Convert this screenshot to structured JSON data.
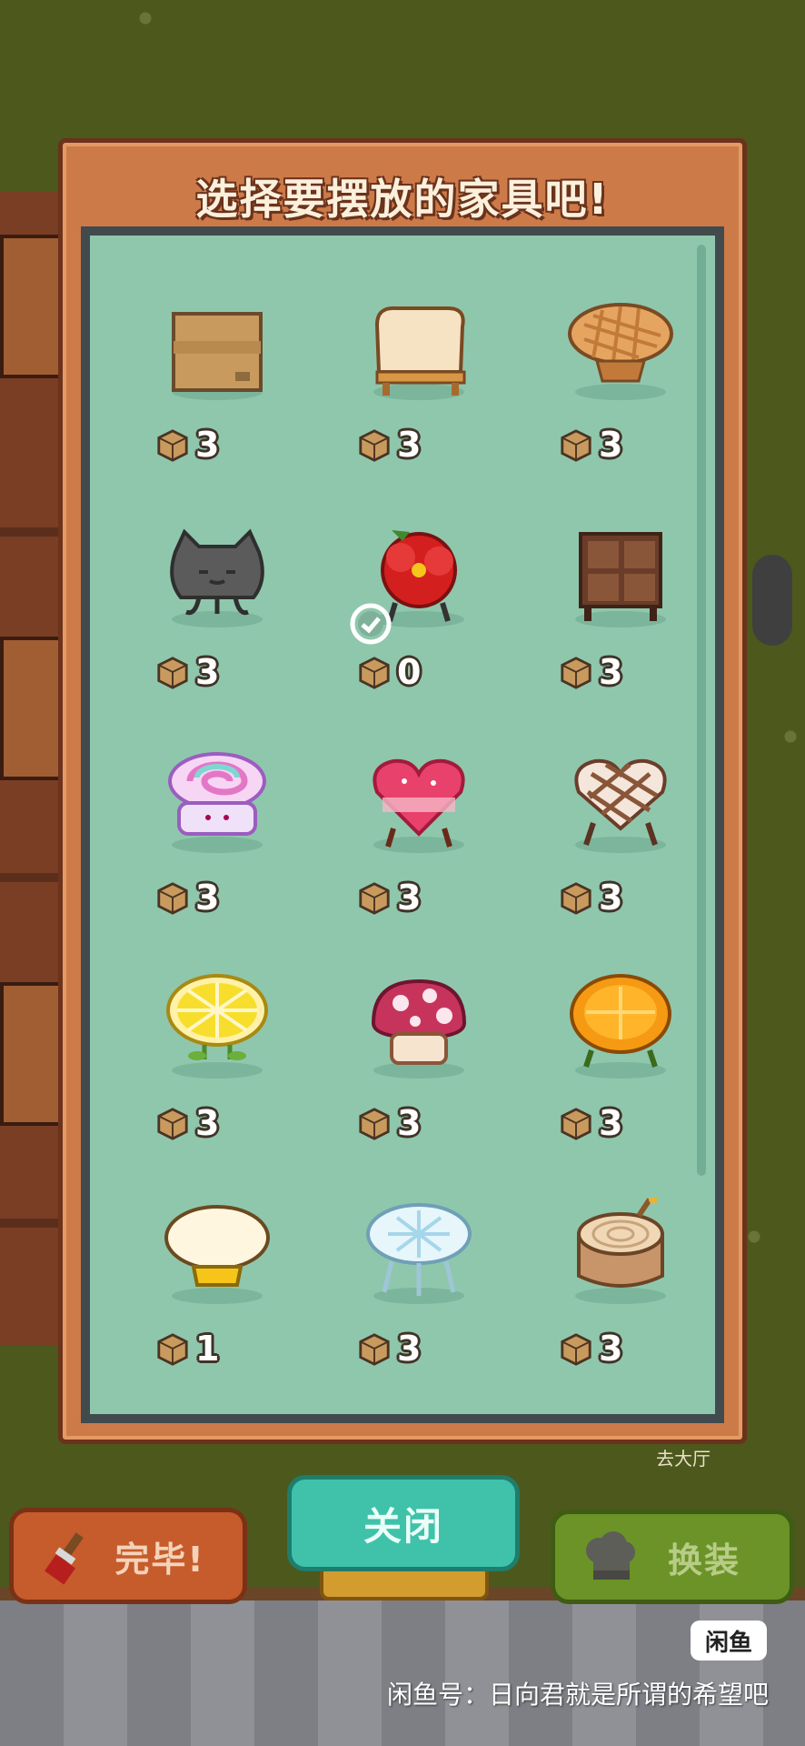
{
  "dialog": {
    "title": "选择要摆放的家具吧!",
    "items": [
      {
        "name": "cardboard-box-table-icon",
        "count": "3"
      },
      {
        "name": "toast-table-icon",
        "count": "3"
      },
      {
        "name": "waffle-round-table-icon",
        "count": "3"
      },
      {
        "name": "black-cat-table-icon",
        "count": "3"
      },
      {
        "name": "red-flower-stool-icon",
        "count": "0",
        "selected": true
      },
      {
        "name": "chocolate-bar-table-icon",
        "count": "3"
      },
      {
        "name": "lollipop-table-icon",
        "count": "3"
      },
      {
        "name": "pink-heart-cake-table-icon",
        "count": "3"
      },
      {
        "name": "checker-heart-table-icon",
        "count": "3"
      },
      {
        "name": "lemon-slice-table-icon",
        "count": "3"
      },
      {
        "name": "mushroom-stool-icon",
        "count": "3"
      },
      {
        "name": "orange-slice-table-icon",
        "count": "3"
      },
      {
        "name": "custard-round-table-icon",
        "count": "1"
      },
      {
        "name": "ice-crystal-table-icon",
        "count": "3"
      },
      {
        "name": "tree-stump-table-icon",
        "count": "3"
      }
    ]
  },
  "buttons": {
    "done_label": "完毕!",
    "close_label": "关闭",
    "swap_label": "换装"
  },
  "background": {
    "go_hall_label": "去大厅"
  },
  "watermark": {
    "logo": "闲鱼",
    "text": "闲鱼号：日向君就是所谓的希望吧"
  },
  "colors": {
    "dialog_frame": "#cd7a49",
    "panel_bg": "#8fc7ad",
    "close_button": "#3fc2a9",
    "done_button": "#c65b2c",
    "swap_button": "#6b9327"
  }
}
